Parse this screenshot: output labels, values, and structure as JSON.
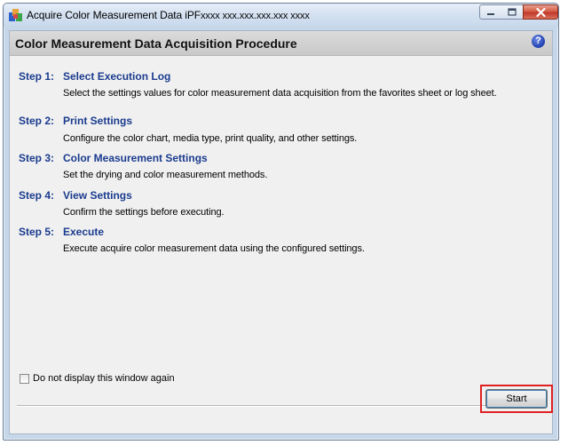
{
  "window": {
    "title": "Acquire Color Measurement Data iPF",
    "title_model": "xxxx xxx.xxx.xxx.xxx xxxx"
  },
  "header": {
    "title": "Color Measurement Data Acquisition Procedure",
    "help_glyph": "?"
  },
  "steps": [
    {
      "label": "Step 1:",
      "title": "Select Execution Log",
      "description": "Select the settings values for color measurement data acquisition from the favorites sheet or log sheet."
    },
    {
      "label": "Step 2:",
      "title": "Print Settings",
      "description": "Configure the color chart, media type, print quality, and other settings."
    },
    {
      "label": "Step 3:",
      "title": "Color Measurement Settings",
      "description": "Set the drying and color measurement methods."
    },
    {
      "label": "Step 4:",
      "title": "View Settings",
      "description": "Confirm the settings before executing."
    },
    {
      "label": "Step 5:",
      "title": "Execute",
      "description": "Execute acquire color measurement data using the configured settings."
    }
  ],
  "options": {
    "dont_show_label": "Do not display this window again",
    "dont_show_checked": false
  },
  "footer": {
    "start_label": "Start"
  },
  "colors": {
    "step_text": "#1a3b8e",
    "highlight": "#e02020"
  }
}
